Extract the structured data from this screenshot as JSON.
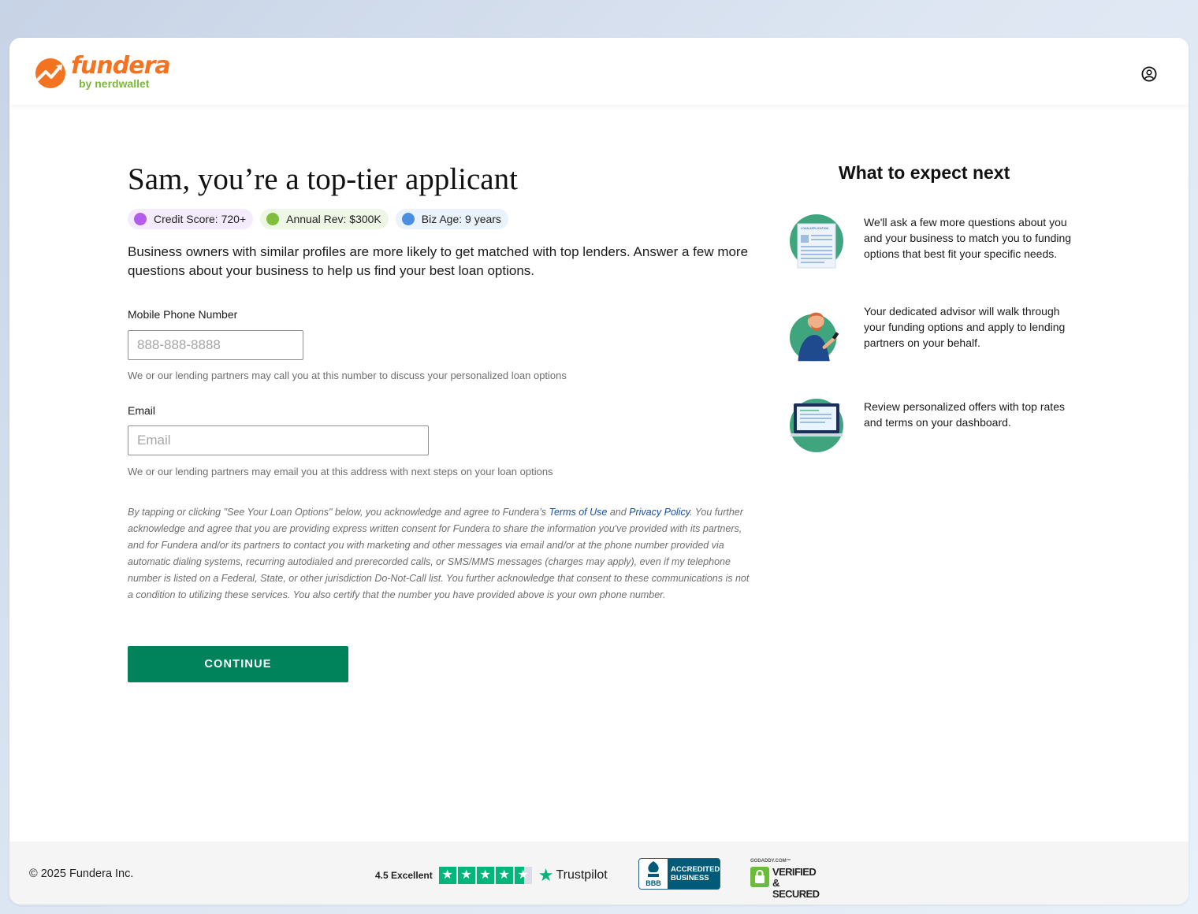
{
  "brand": {
    "name": "fundera",
    "tagline": "by nerdwallet",
    "colors": {
      "orange": "#f47321",
      "green": "#7ab83b",
      "cta": "#00835a",
      "link": "#1a4fa0"
    }
  },
  "header": {
    "account_icon": "user-circle-icon"
  },
  "main": {
    "title": "Sam, you’re a top-tier applicant",
    "chips": [
      {
        "label": "Credit Score: 720+",
        "dot_color": "#b35ded",
        "bg": "#f4ecfd"
      },
      {
        "label": "Annual Rev: $300K",
        "dot_color": "#7ec03c",
        "bg": "#eef6e6"
      },
      {
        "label": "Biz Age: 9 years",
        "dot_color": "#4a90e2",
        "bg": "#eaf2fb"
      }
    ],
    "description": "Business owners with similar profiles are more likely to get matched with top lenders. Answer a few more questions about your business to help us find your best loan options.",
    "phone": {
      "label": "Mobile Phone Number",
      "placeholder": "888-888-8888",
      "value": "",
      "help": "We or our lending partners may call you at this number to discuss your personalized loan options"
    },
    "email": {
      "label": "Email",
      "placeholder": "Email",
      "value": "",
      "help": "We or our lending partners may email you at this address with next steps on your loan options"
    },
    "legal": {
      "part1": "By tapping or clicking \"See Your Loan Options\" below, you acknowledge and agree to Fundera’s ",
      "terms_link": "Terms of Use",
      "and": " and ",
      "privacy_link": "Privacy Policy",
      "part2": ". You further acknowledge and agree that you are providing express written consent for Fundera to share the information you've provided with its partners, and for Fundera and/or its partners to contact you with marketing and other messages via email and/or at the phone number provided via automatic dialing systems, recurring autodialed and prerecorded calls, or SMS/MMS messages (charges may apply), even if my telephone number is listed on a Federal, State, or other jurisdiction Do-Not-Call list. You further acknowledge that consent to these communications is not a condition to utilizing these services. You also certify that the number you have provided above is your own phone number."
    },
    "continue_label": "CONTINUE"
  },
  "sidebar": {
    "title": "What to expect next",
    "steps": [
      {
        "icon": "loan-application-icon",
        "text": "We'll ask a few more questions about you and your business to match you to funding options that best fit your specific needs.",
        "icon_label": "LOAN APPLICATION"
      },
      {
        "icon": "advisor-icon",
        "text": "Your dedicated advisor will walk through your funding options and apply to lending partners on your behalf."
      },
      {
        "icon": "laptop-dashboard-icon",
        "text": "Review personalized offers with top rates and terms on your dashboard."
      }
    ]
  },
  "footer": {
    "copyright": "© 2025 Fundera Inc.",
    "trustpilot": {
      "score_text": "4.5 Excellent",
      "rating": 4.5,
      "brand": "Trustpilot"
    },
    "bbb": {
      "line1": "ACCREDITED",
      "line2": "BUSINESS",
      "mark": "BBB"
    },
    "godaddy": {
      "top": "GODADDY.COM™",
      "line1": "VERIFIED",
      "line2": "& SECURED"
    }
  }
}
